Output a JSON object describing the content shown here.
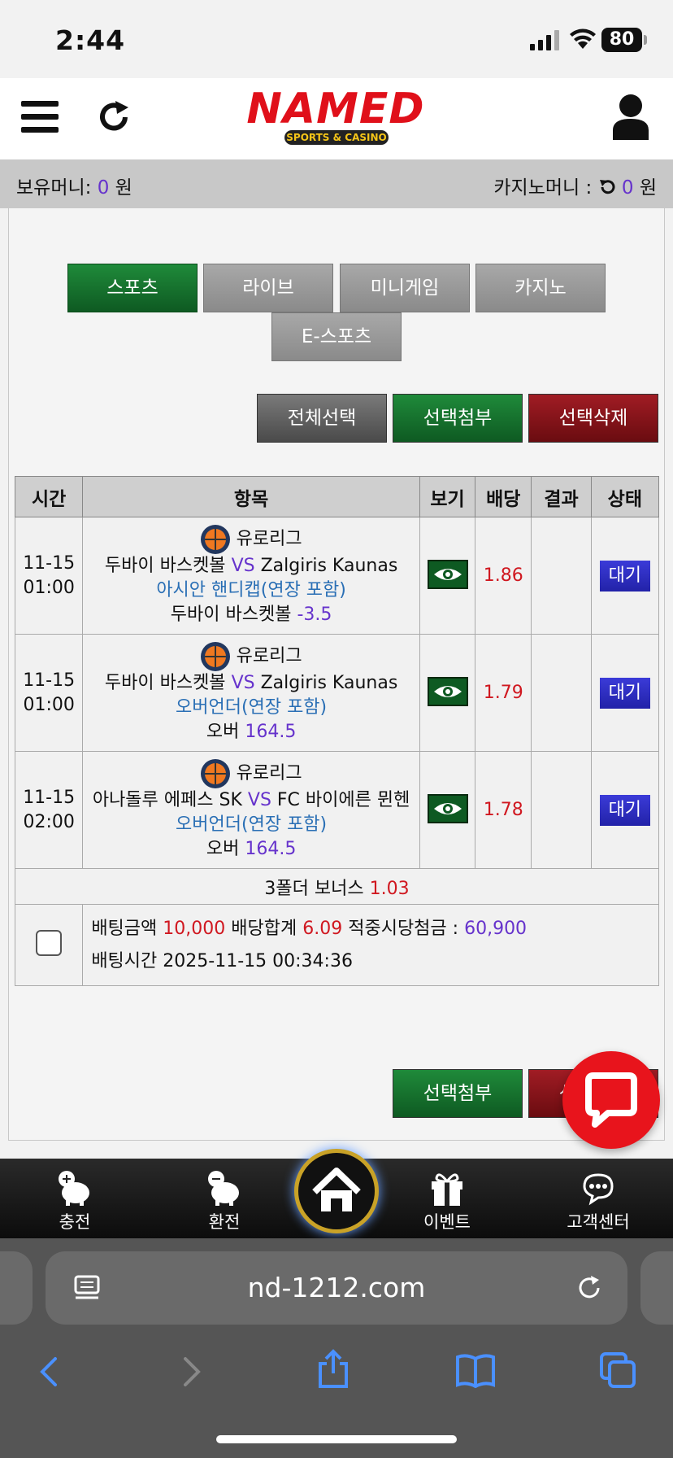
{
  "status": {
    "time": "2:44",
    "battery": "80"
  },
  "header": {
    "logo_main": "NAMED",
    "logo_sub": "SPORTS & CASINO"
  },
  "money": {
    "holding_label": "보유머니:",
    "holding_value": "0",
    "holding_unit": "원",
    "casino_label": "카지노머니 :",
    "casino_value": "0",
    "casino_unit": "원"
  },
  "tabs": [
    {
      "label": "스포츠",
      "active": true
    },
    {
      "label": "라이브"
    },
    {
      "label": "미니게임"
    },
    {
      "label": "카지노"
    },
    {
      "label": "E-스포츠"
    }
  ],
  "actions": {
    "select_all": "전체선택",
    "attach_selected": "선택첨부",
    "delete_selected": "선택삭제"
  },
  "table": {
    "headers": [
      "시간",
      "항목",
      "보기",
      "배당",
      "결과",
      "상태"
    ],
    "rows": [
      {
        "date": "11-15",
        "time": "01:00",
        "league": "유로리그",
        "home": "두바이 바스켓볼",
        "vs": "VS",
        "away": "Zalgiris Kaunas",
        "market": "아시안 핸디캡(연장 포함)",
        "pick": "두바이 바스켓볼",
        "pick_value": "-3.5",
        "odds": "1.86",
        "result": "",
        "status": "대기"
      },
      {
        "date": "11-15",
        "time": "01:00",
        "league": "유로리그",
        "home": "두바이 바스켓볼",
        "vs": "VS",
        "away": "Zalgiris Kaunas",
        "market": "오버언더(연장 포함)",
        "pick": "오버",
        "pick_value": "164.5",
        "odds": "1.79",
        "result": "",
        "status": "대기"
      },
      {
        "date": "11-15",
        "time": "02:00",
        "league": "유로리그",
        "home": "아나돌루 에페스 SK",
        "vs": "VS",
        "away": "FC 바이에른 뮌헨",
        "market": "오버언더(연장 포함)",
        "pick": "오버",
        "pick_value": "164.5",
        "odds": "1.78",
        "result": "",
        "status": "대기"
      }
    ],
    "bonus_label": "3폴더 보너스",
    "bonus_value": "1.03",
    "summary": {
      "bet_amount_label": "배팅금액",
      "bet_amount": "10,000",
      "total_odds_label": "배당합계",
      "total_odds": "6.09",
      "win_label": "적중시당첨금 :",
      "win_amount": "60,900",
      "bet_time_label": "배팅시간",
      "bet_time": "2025-11-15 00:34:36"
    }
  },
  "bottom_actions": {
    "attach_selected": "선택첨부",
    "delete_selected": "선택삭제"
  },
  "bottom_nav": [
    {
      "label": "충전",
      "icon": "piggy-plus-icon"
    },
    {
      "label": "환전",
      "icon": "piggy-minus-icon"
    },
    {
      "label": "",
      "icon": "home-icon"
    },
    {
      "label": "이벤트",
      "icon": "gift-icon"
    },
    {
      "label": "고객센터",
      "icon": "support-chat-icon"
    }
  ],
  "browser": {
    "url": "nd-1212.com"
  },
  "colors": {
    "accent_green": "#0e5a22",
    "accent_red": "#d01820",
    "accent_purple": "#6633cc",
    "accent_blue": "#2a6fb5"
  }
}
